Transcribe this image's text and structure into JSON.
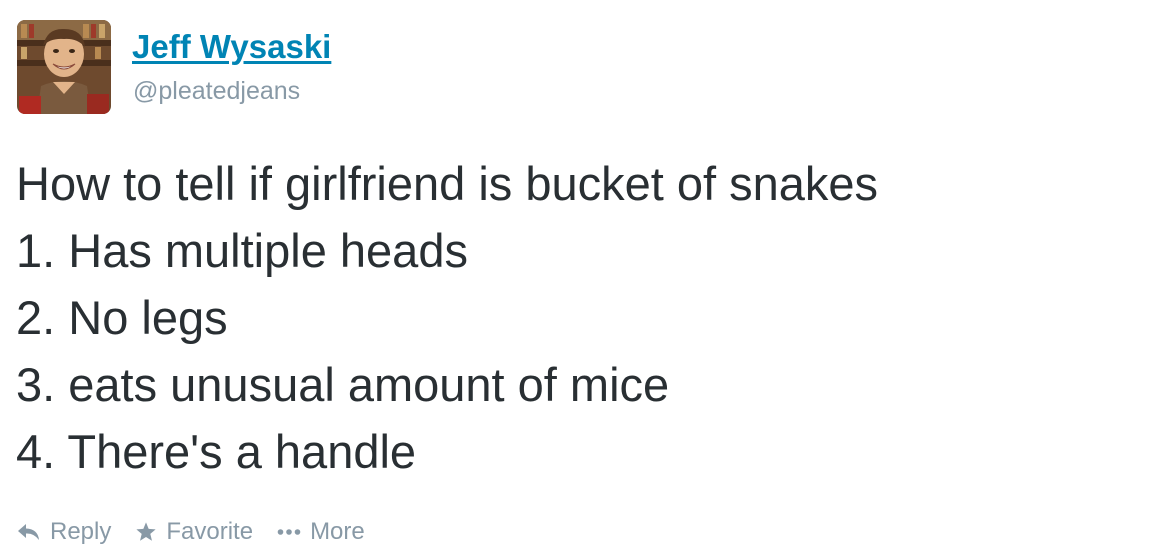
{
  "author": {
    "name": "Jeff Wysaski",
    "handle": "@pleatedjeans",
    "avatar_icon": "user-avatar-photo"
  },
  "tweet": {
    "lines": [
      "How to tell if girlfriend is bucket of snakes",
      "1. Has multiple heads",
      "2. No legs",
      "3. eats unusual amount of mice",
      "4. There's a handle"
    ]
  },
  "actions": {
    "reply": {
      "label": "Reply",
      "icon": "reply-icon"
    },
    "favorite": {
      "label": "Favorite",
      "icon": "star-icon"
    },
    "more": {
      "label": "More",
      "icon": "ellipsis-icon"
    }
  },
  "colors": {
    "link": "#0084b4",
    "text": "#292f33",
    "muted": "#8899a6"
  }
}
